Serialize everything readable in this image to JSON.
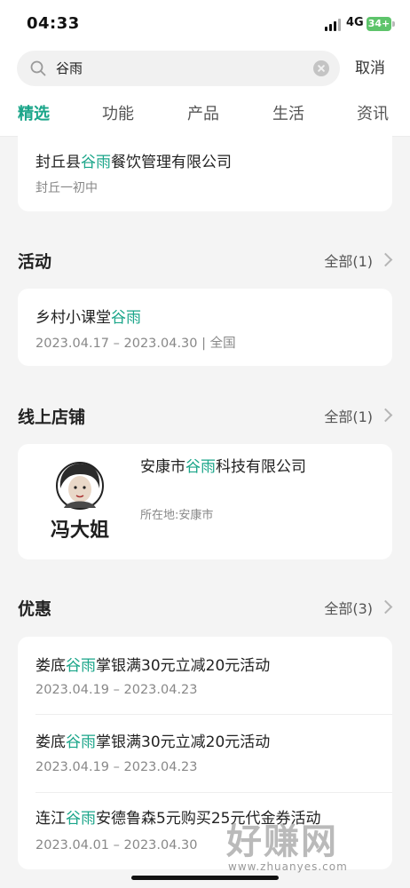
{
  "status_bar": {
    "time": "04:33",
    "network": "4G",
    "battery": "34+"
  },
  "search": {
    "query": "谷雨",
    "cancel_label": "取消"
  },
  "tabs": [
    "精选",
    "功能",
    "产品",
    "生活",
    "资讯"
  ],
  "active_tab": "精选",
  "top_card": {
    "title_pre": "封丘县",
    "title_hl": "谷雨",
    "title_post": "餐饮管理有限公司",
    "subtitle": "封丘一初中"
  },
  "activity": {
    "title": "活动",
    "more": "全部(1)",
    "item": {
      "title_pre": "乡村小课堂",
      "title_hl": "谷雨",
      "title_post": "",
      "meta": "2023.04.17 – 2023.04.30 | 全国"
    }
  },
  "online_store": {
    "title": "线上店铺",
    "more": "全部(1)",
    "item": {
      "name_pre": "安康市",
      "name_hl": "谷雨",
      "name_post": "科技有限公司",
      "location": "所在地:安康市",
      "logo_text": "冯大姐",
      "logo_icon": "portrait-logo"
    }
  },
  "offers": {
    "title": "优惠",
    "more": "全部(3)",
    "items": [
      {
        "pre": "娄底",
        "hl": "谷雨",
        "post": "掌银满30元立减20元活动",
        "date": "2023.04.19 – 2023.04.23"
      },
      {
        "pre": "娄底",
        "hl": "谷雨",
        "post": "掌银满30元立减20元活动",
        "date": "2023.04.19 – 2023.04.23"
      },
      {
        "pre": "连江",
        "hl": "谷雨",
        "post": "安德鲁森5元购买25元代金券活动",
        "date": "2023.04.01 – 2023.04.30"
      }
    ]
  },
  "watermark": {
    "big": "好赚网",
    "small": "www.zhuanyes.com"
  },
  "colors": {
    "accent": "#1aa589",
    "background": "#f4f4f4"
  }
}
